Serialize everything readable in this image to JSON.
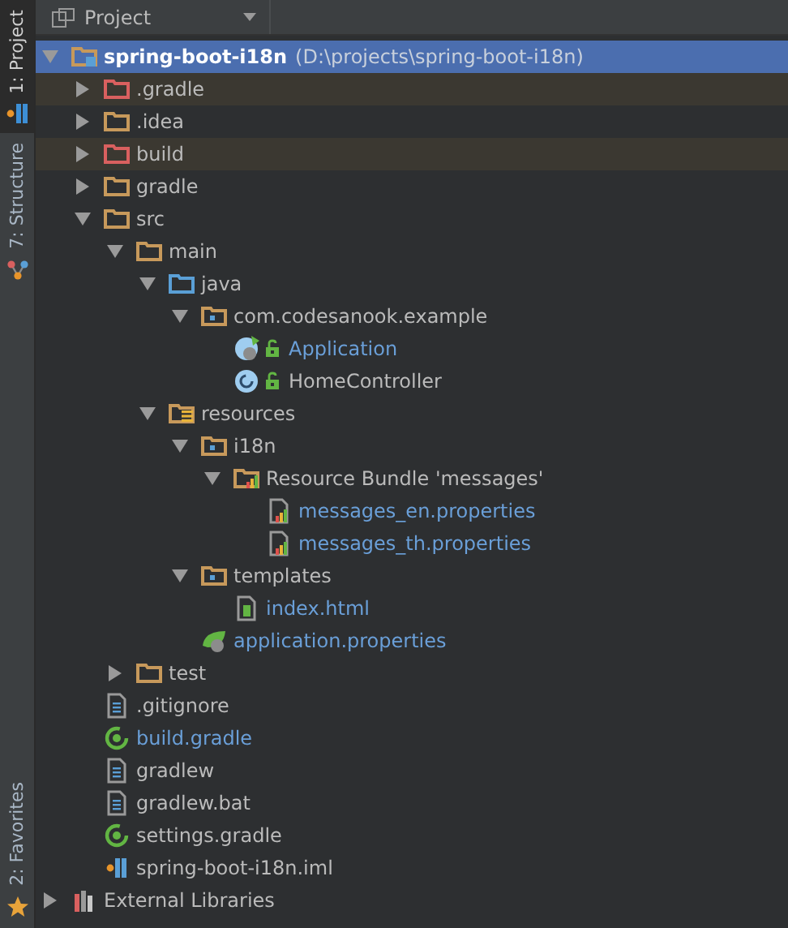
{
  "side_tabs": [
    {
      "label": "1: Project",
      "selected": true,
      "kind": "module"
    },
    {
      "label": "7: Structure",
      "selected": false,
      "kind": "structure"
    }
  ],
  "bottom_tabs": [
    {
      "label": "2: Favorites",
      "selected": false,
      "kind": "star"
    }
  ],
  "panel": {
    "title": "Project"
  },
  "tree": [
    {
      "name": "spring-boot-i18n",
      "path": "(D:\\projects\\spring-boot-i18n)",
      "kind": "module",
      "expanded": true,
      "selected": true,
      "children": [
        {
          "name": ".gradle",
          "kind": "excluded",
          "expanded": false,
          "selected": false
        },
        {
          "name": ".idea",
          "kind": "folder",
          "expanded": false,
          "selected": false
        },
        {
          "name": "build",
          "kind": "excluded",
          "expanded": false,
          "selected": false
        },
        {
          "name": "gradle",
          "kind": "folder",
          "expanded": false,
          "selected": false
        },
        {
          "name": "src",
          "kind": "folder",
          "expanded": true,
          "selected": false,
          "children": [
            {
              "name": "main",
              "kind": "folder",
              "expanded": true,
              "selected": false,
              "children": [
                {
                  "name": "java",
                  "kind": "source",
                  "expanded": true,
                  "selected": false,
                  "children": [
                    {
                      "name": "com.codesanook.example",
                      "kind": "package",
                      "expanded": true,
                      "selected": false,
                      "children": [
                        {
                          "name": "Application",
                          "kind": "spring-class",
                          "changed": true,
                          "public": true,
                          "selected": false
                        },
                        {
                          "name": "HomeController",
                          "kind": "class",
                          "changed": false,
                          "public": true,
                          "selected": false
                        }
                      ]
                    }
                  ]
                },
                {
                  "name": "resources",
                  "kind": "resources",
                  "expanded": true,
                  "selected": false,
                  "children": [
                    {
                      "name": "i18n",
                      "kind": "package",
                      "expanded": true,
                      "selected": false,
                      "children": [
                        {
                          "name": "Resource Bundle 'messages'",
                          "kind": "bundle",
                          "expanded": true,
                          "selected": false,
                          "children": [
                            {
                              "name": "messages_en.properties",
                              "kind": "properties",
                              "changed": true,
                              "selected": false
                            },
                            {
                              "name": "messages_th.properties",
                              "kind": "properties",
                              "changed": true,
                              "selected": false
                            }
                          ]
                        }
                      ]
                    },
                    {
                      "name": "templates",
                      "kind": "package",
                      "expanded": true,
                      "selected": false,
                      "children": [
                        {
                          "name": "index.html",
                          "kind": "html",
                          "changed": true,
                          "selected": false
                        }
                      ]
                    },
                    {
                      "name": "application.properties",
                      "kind": "spring-properties",
                      "changed": true,
                      "selected": false
                    }
                  ]
                }
              ]
            },
            {
              "name": "test",
              "kind": "folder",
              "expanded": false,
              "selected": false
            }
          ]
        },
        {
          "name": ".gitignore",
          "kind": "text",
          "changed": false,
          "selected": false
        },
        {
          "name": "build.gradle",
          "kind": "gradle",
          "changed": true,
          "selected": false
        },
        {
          "name": "gradlew",
          "kind": "text",
          "changed": false,
          "selected": false
        },
        {
          "name": "gradlew.bat",
          "kind": "text",
          "changed": false,
          "selected": false
        },
        {
          "name": "settings.gradle",
          "kind": "gradle",
          "changed": false,
          "selected": false
        },
        {
          "name": "spring-boot-i18n.iml",
          "kind": "iml",
          "changed": false,
          "selected": false
        }
      ]
    },
    {
      "name": "External Libraries",
      "kind": "libraries",
      "expanded": false,
      "selected": false
    }
  ]
}
